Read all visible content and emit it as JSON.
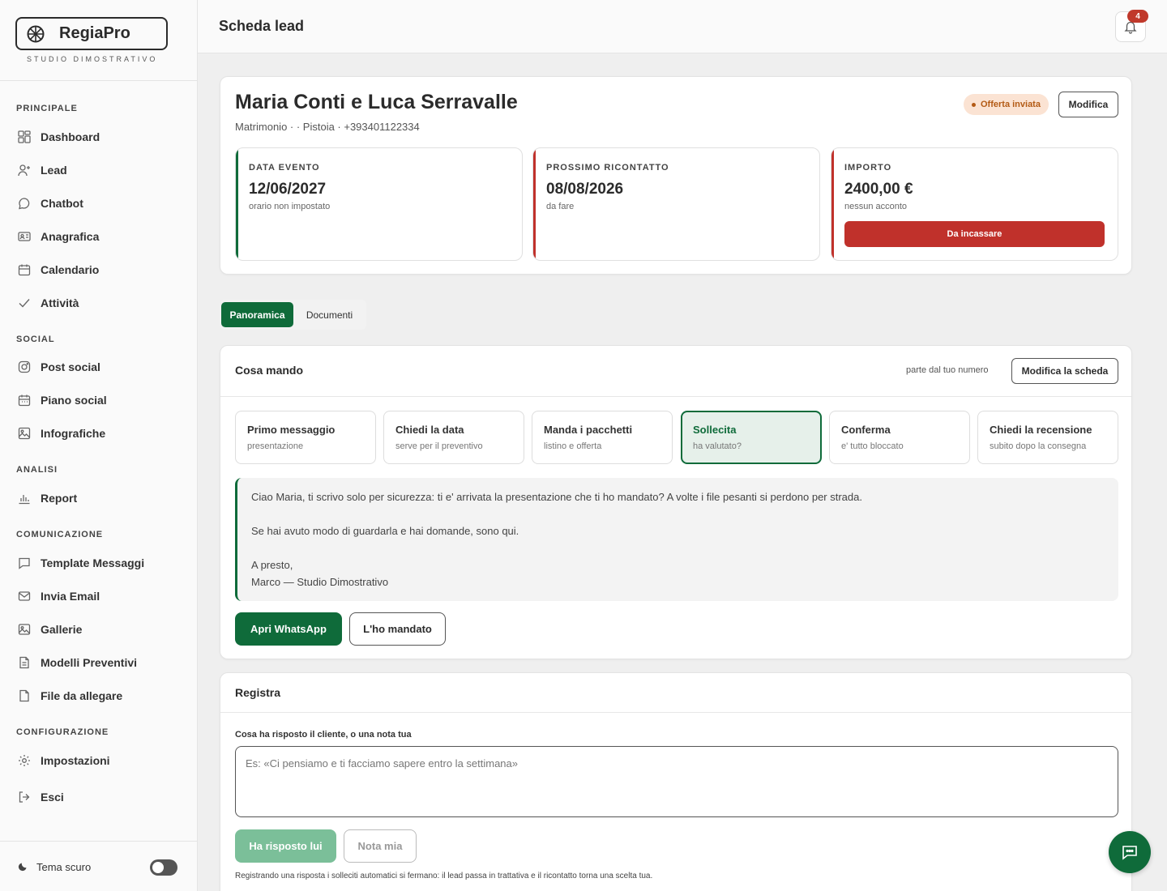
{
  "brand": {
    "name": "RegiaPro",
    "subtitle": "STUDIO DIMOSTRATIVO"
  },
  "sidebar": {
    "sections": [
      {
        "title": "PRINCIPALE",
        "items": [
          "Dashboard",
          "Lead",
          "Chatbot",
          "Anagrafica",
          "Calendario",
          "Attività"
        ]
      },
      {
        "title": "SOCIAL",
        "items": [
          "Post social",
          "Piano social",
          "Infografiche"
        ]
      },
      {
        "title": "ANALISI",
        "items": [
          "Report"
        ]
      },
      {
        "title": "COMUNICAZIONE",
        "items": [
          "Template Messaggi",
          "Invia Email",
          "Gallerie",
          "Modelli Preventivi",
          "File da allegare"
        ]
      },
      {
        "title": "CONFIGURAZIONE",
        "items": [
          "Impostazioni",
          "Esci"
        ]
      }
    ],
    "theme_label": "Tema scuro"
  },
  "header": {
    "title": "Scheda lead",
    "notifications": "4"
  },
  "lead": {
    "name": "Maria Conti e Luca Serravalle",
    "meta": "Matrimonio · · Pistoia · +393401122334",
    "status": "Offerta inviata",
    "edit_label": "Modifica",
    "stats": [
      {
        "label": "DATA EVENTO",
        "value": "12/06/2027",
        "sub": "orario non impostato"
      },
      {
        "label": "PROSSIMO RICONTATTO",
        "value": "08/08/2026",
        "sub": "da fare"
      },
      {
        "label": "IMPORTO",
        "value": "2400,00 €",
        "sub": "nessun acconto",
        "action": "Da incassare"
      }
    ]
  },
  "tabs": [
    "Panoramica",
    "Documenti"
  ],
  "send": {
    "title": "Cosa mando",
    "hint": "parte dal tuo numero",
    "edit_label": "Modifica la scheda",
    "steps": [
      {
        "title": "Primo messaggio",
        "desc": "presentazione"
      },
      {
        "title": "Chiedi la data",
        "desc": "serve per il preventivo"
      },
      {
        "title": "Manda i pacchetti",
        "desc": "listino e offerta"
      },
      {
        "title": "Sollecita",
        "desc": "ha valutato?"
      },
      {
        "title": "Conferma",
        "desc": "e' tutto bloccato"
      },
      {
        "title": "Chiedi la recensione",
        "desc": "subito dopo la consegna"
      }
    ],
    "message": [
      "Ciao Maria, ti scrivo solo per sicurezza: ti e' arrivata la presentazione che ti ho mandato? A volte i file pesanti si perdono per strada.",
      "Se hai avuto modo di guardarla e hai domande, sono qui.",
      "A presto,",
      "Marco — Studio Dimostrativo"
    ],
    "whatsapp_label": "Apri WhatsApp",
    "sent_label": "L'ho mandato"
  },
  "register": {
    "title": "Registra",
    "field_label": "Cosa ha risposto il cliente, o una nota tua",
    "placeholder": "Es: «Ci pensiamo e ti facciamo sapere entro la settimana»",
    "reply_label": "Ha risposto lui",
    "note_label": "Nota mia",
    "footnote": "Registrando una risposta i solleciti automatici si fermano: il lead passa in trattativa e il ricontatto torna una scelta tua."
  },
  "colors": {
    "accent": "#0f6b3a",
    "danger": "#c0312b",
    "badge_bg": "#fbe3d3",
    "badge_fg": "#b35a14"
  }
}
